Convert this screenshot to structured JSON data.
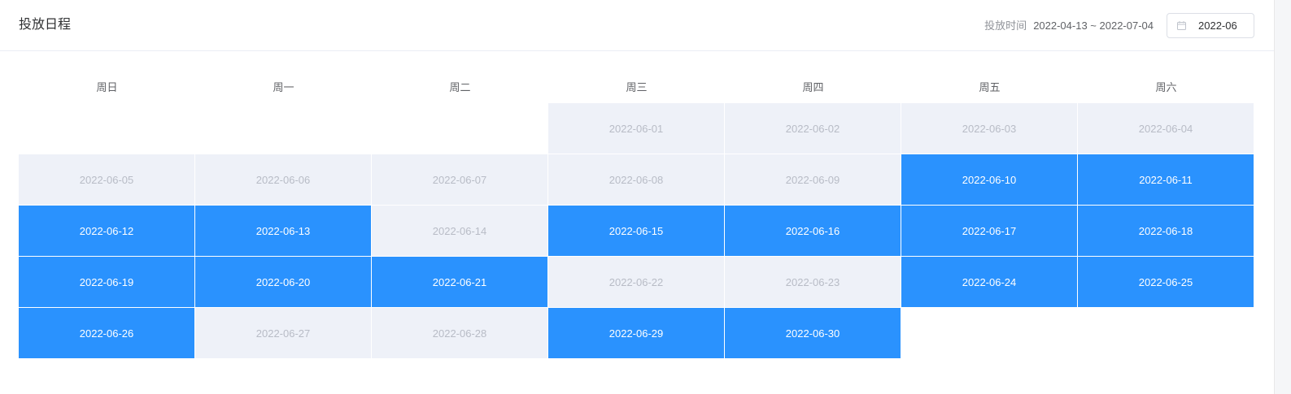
{
  "header": {
    "title": "投放日程",
    "period_label": "投放时间",
    "period_range": "2022-04-13 ~ 2022-07-04",
    "month_value": "2022-06"
  },
  "icons": {
    "picker_icon": "calendar-icon"
  },
  "colors": {
    "selected": "#2a92fe",
    "unselected": "#eef1f8",
    "selected_text": "#ffffff",
    "unselected_text": "#b8bcc6"
  },
  "calendar": {
    "weekdays": [
      "周日",
      "周一",
      "周二",
      "周三",
      "周四",
      "周五",
      "周六"
    ],
    "leading_blanks": 3,
    "days": [
      {
        "date": "2022-06-01",
        "active": false
      },
      {
        "date": "2022-06-02",
        "active": false
      },
      {
        "date": "2022-06-03",
        "active": false
      },
      {
        "date": "2022-06-04",
        "active": false
      },
      {
        "date": "2022-06-05",
        "active": false
      },
      {
        "date": "2022-06-06",
        "active": false
      },
      {
        "date": "2022-06-07",
        "active": false
      },
      {
        "date": "2022-06-08",
        "active": false
      },
      {
        "date": "2022-06-09",
        "active": false
      },
      {
        "date": "2022-06-10",
        "active": true
      },
      {
        "date": "2022-06-11",
        "active": true
      },
      {
        "date": "2022-06-12",
        "active": true
      },
      {
        "date": "2022-06-13",
        "active": true
      },
      {
        "date": "2022-06-14",
        "active": false
      },
      {
        "date": "2022-06-15",
        "active": true
      },
      {
        "date": "2022-06-16",
        "active": true
      },
      {
        "date": "2022-06-17",
        "active": true
      },
      {
        "date": "2022-06-18",
        "active": true
      },
      {
        "date": "2022-06-19",
        "active": true
      },
      {
        "date": "2022-06-20",
        "active": true
      },
      {
        "date": "2022-06-21",
        "active": true
      },
      {
        "date": "2022-06-22",
        "active": false
      },
      {
        "date": "2022-06-23",
        "active": false
      },
      {
        "date": "2022-06-24",
        "active": true
      },
      {
        "date": "2022-06-25",
        "active": true
      },
      {
        "date": "2022-06-26",
        "active": true
      },
      {
        "date": "2022-06-27",
        "active": false
      },
      {
        "date": "2022-06-28",
        "active": false
      },
      {
        "date": "2022-06-29",
        "active": true
      },
      {
        "date": "2022-06-30",
        "active": true
      }
    ]
  }
}
